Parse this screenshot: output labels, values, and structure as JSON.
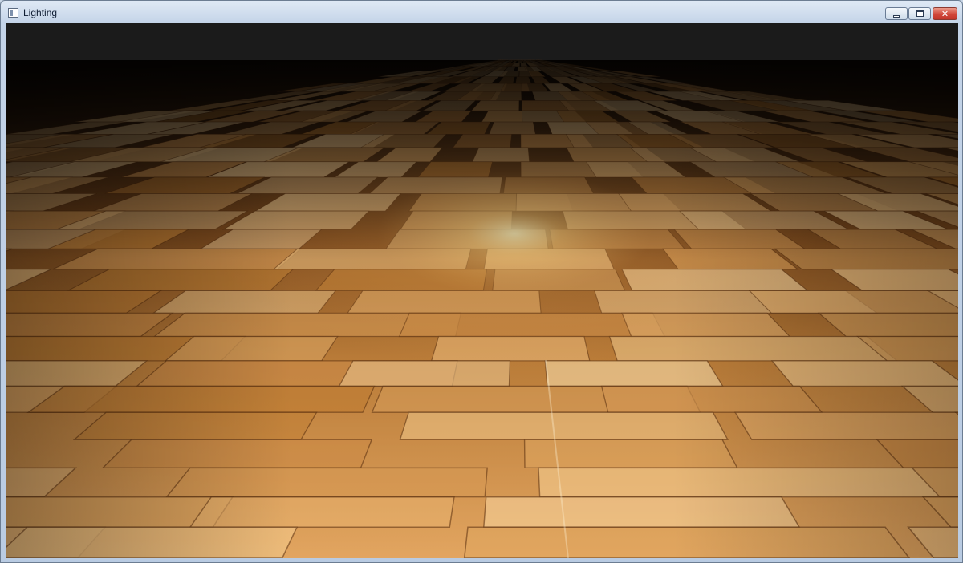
{
  "window": {
    "title": "Lighting",
    "icons": {
      "app": "app-window-icon",
      "minimize": "minimize-icon",
      "maximize": "maximize-icon",
      "close": "close-icon"
    }
  },
  "scene": {
    "description_icon": "wood-floor-render",
    "colors": {
      "sky": "#1b1b1b",
      "wood_light": "#e8b574",
      "wood_mid": "#c98437",
      "wood_dark": "#6b3a12",
      "plank_line": "#5a2e0c",
      "highlight": "#ffd98a"
    }
  }
}
